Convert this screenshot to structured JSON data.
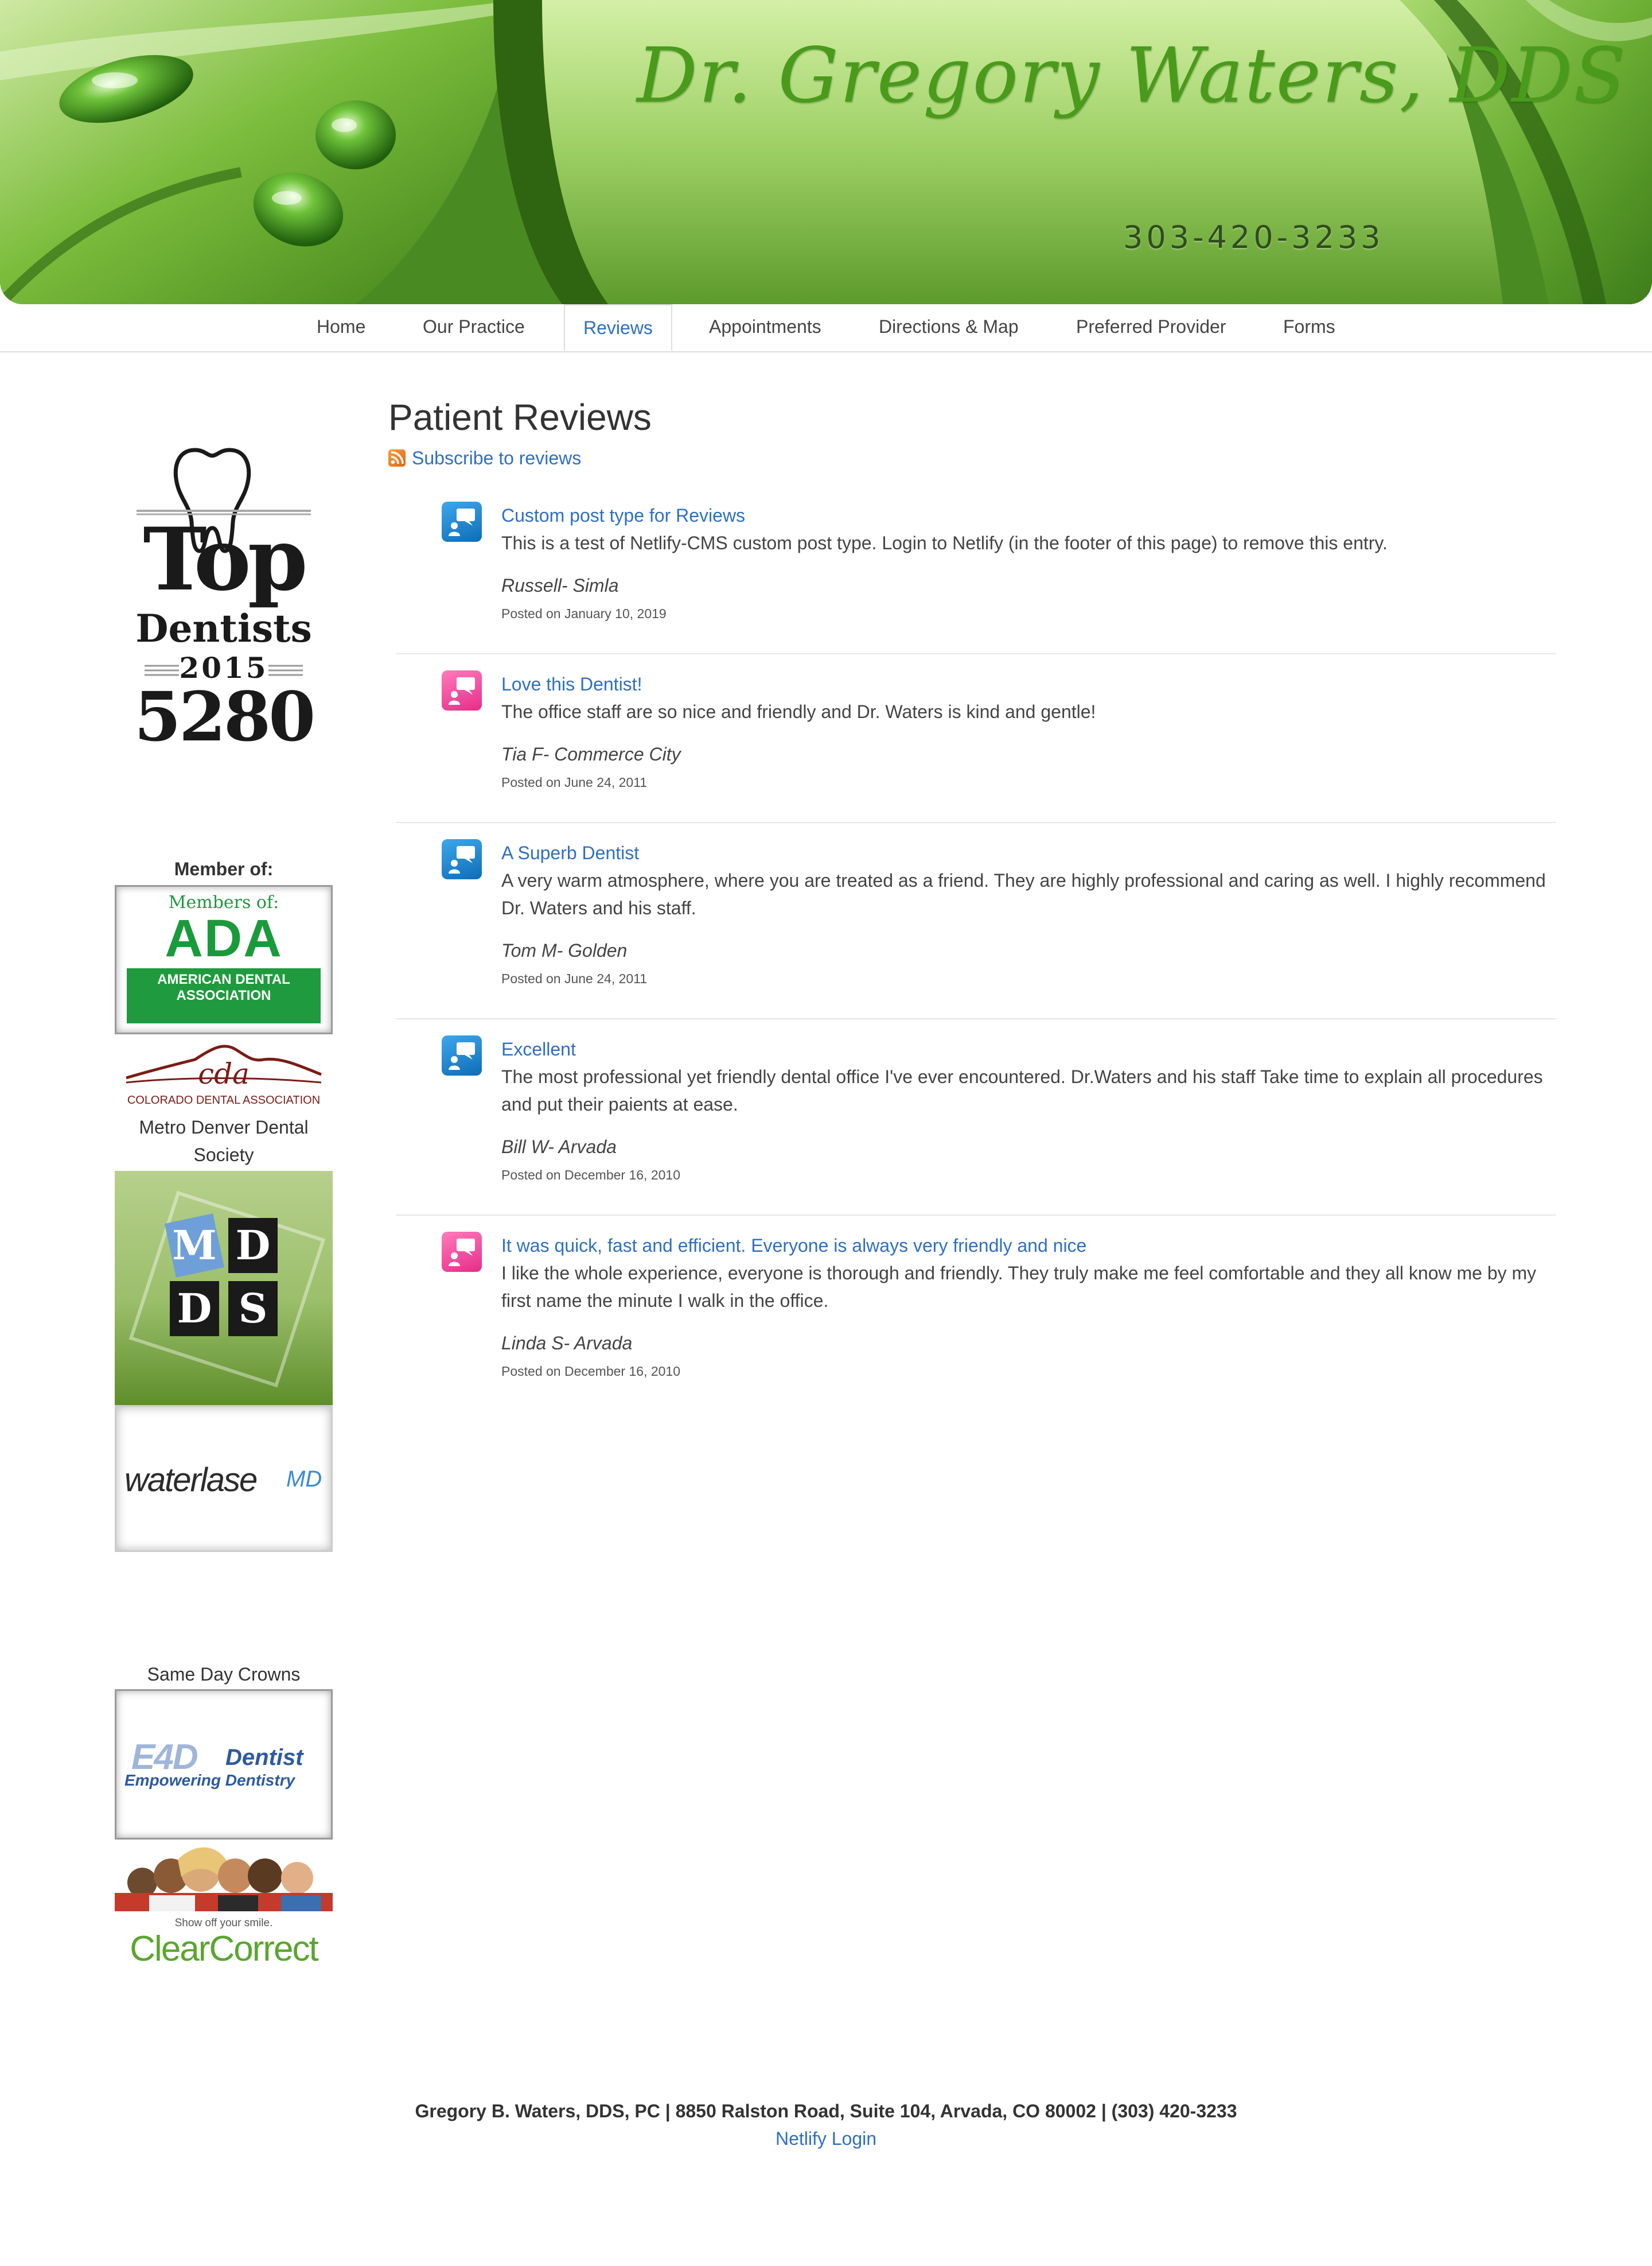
{
  "header": {
    "title": "Dr. Gregory Waters, DDS",
    "phone": "303-420-3233"
  },
  "nav": {
    "items": [
      "Home",
      "Our Practice",
      "Reviews",
      "Appointments",
      "Directions & Map",
      "Preferred Provider",
      "Forms"
    ],
    "active": "Reviews"
  },
  "sidebar": {
    "top_dentists": {
      "top": "Top",
      "dentists": "Dentists",
      "year": "2015",
      "mag": "5280"
    },
    "member_of_label": "Member of:",
    "ada": {
      "line1": "Members of:",
      "line2": "ADA",
      "line3": "AMERICAN DENTAL",
      "line4": "ASSOCIATION"
    },
    "cda": {
      "abbr": "cda",
      "name": "COLORADO DENTAL ASSOCIATION"
    },
    "mdds_label": "Metro Denver Dental Society",
    "mdds_letters": [
      "M",
      "D",
      "D",
      "S"
    ],
    "waterlase": {
      "brand": "waterlase",
      "suffix": "MD"
    },
    "same_day_crowns_label": "Same Day Crowns",
    "e4d": {
      "brand": "E4D",
      "word": "Dentist",
      "tagline": "Empowering Dentistry"
    },
    "clearcorrect": {
      "tagline": "Show off your smile.",
      "brand": "ClearCorrect"
    }
  },
  "main": {
    "title": "Patient Reviews",
    "subscribe_label": "Subscribe to reviews",
    "reviews": [
      {
        "title": "Custom post type for Reviews",
        "body": "This is a test of Netlify-CMS custom post type. Login to Netlify (in the footer of this page) to remove this entry.",
        "author": "Russell- Simla",
        "date": "Posted on January 10, 2019",
        "icon_color": "blue"
      },
      {
        "title": "Love this Dentist!",
        "body": "The office staff are so nice and friendly and Dr. Waters is kind and gentle!",
        "author": "Tia F- Commerce City",
        "date": "Posted on June 24, 2011",
        "icon_color": "pink"
      },
      {
        "title": "A Superb Dentist",
        "body": "A very warm atmosphere, where you are treated as a friend. They are highly professional and caring as well. I highly recommend Dr. Waters and his staff.",
        "author": "Tom M- Golden",
        "date": "Posted on June 24, 2011",
        "icon_color": "blue"
      },
      {
        "title": "Excellent",
        "body": "The most professional yet friendly dental office I've ever encountered. Dr.Waters and his staff Take time to explain all procedures and put their paients at ease.",
        "author": "Bill W- Arvada",
        "date": "Posted on December 16, 2010",
        "icon_color": "blue"
      },
      {
        "title": "It was quick, fast and efficient. Everyone is always very friendly and nice",
        "body": "I like the whole experience, everyone is thorough and friendly. They truly make me feel comfortable and they all know me by my first name the minute I walk in the office.",
        "author": "Linda S- Arvada",
        "date": "Posted on December 16, 2010",
        "icon_color": "pink"
      }
    ]
  },
  "footer": {
    "address": "Gregory B. Waters, DDS, PC | 8850 Ralston Road, Suite 104, Arvada, CO 80002 | (303) 420-3233",
    "login_link": "Netlify Login"
  },
  "colors": {
    "link": "#2e6fc4",
    "icon_blue": "#1a7fd0",
    "icon_pink": "#f0439a",
    "banner_green": "#4f8f24"
  }
}
